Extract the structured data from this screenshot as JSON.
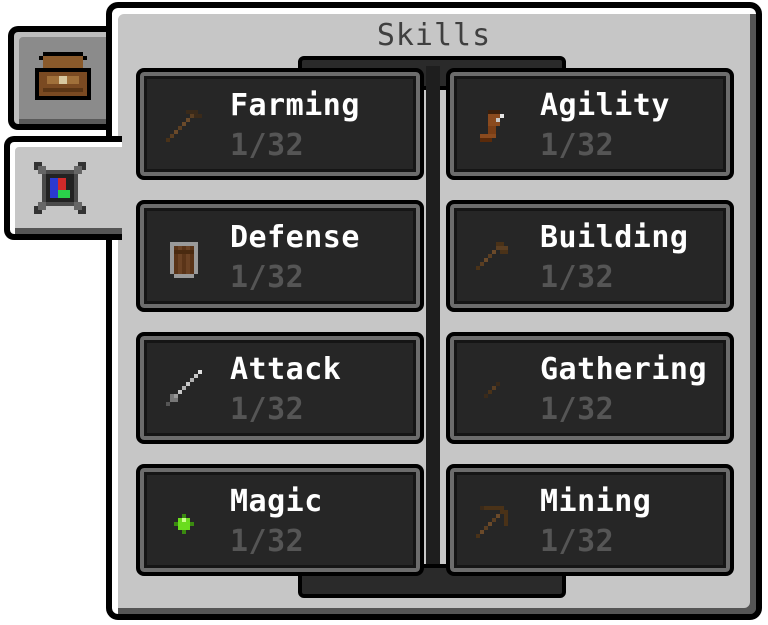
{
  "window": {
    "title": "Skills"
  },
  "tabs": [
    {
      "name": "inventory",
      "icon": "backpack-icon",
      "active": false
    },
    {
      "name": "skills",
      "icon": "skills-compass-icon",
      "active": true
    }
  ],
  "skills": [
    {
      "name": "Farming",
      "level": "1/32",
      "icon": "hoe-icon"
    },
    {
      "name": "Agility",
      "level": "1/32",
      "icon": "boot-icon"
    },
    {
      "name": "Defense",
      "level": "1/32",
      "icon": "shield-icon"
    },
    {
      "name": "Building",
      "level": "1/32",
      "icon": "hammer-icon"
    },
    {
      "name": "Attack",
      "level": "1/32",
      "icon": "sword-icon"
    },
    {
      "name": "Gathering",
      "level": "1/32",
      "icon": "stick-icon"
    },
    {
      "name": "Magic",
      "level": "1/32",
      "icon": "green-orb-icon"
    },
    {
      "name": "Mining",
      "level": "1/32",
      "icon": "pickaxe-icon"
    }
  ],
  "colors": {
    "panel": "#c6c6c6",
    "card": "#262626",
    "title_text": "#3f3f3f",
    "skill_name": "#ffffff",
    "skill_level": "#555555"
  }
}
